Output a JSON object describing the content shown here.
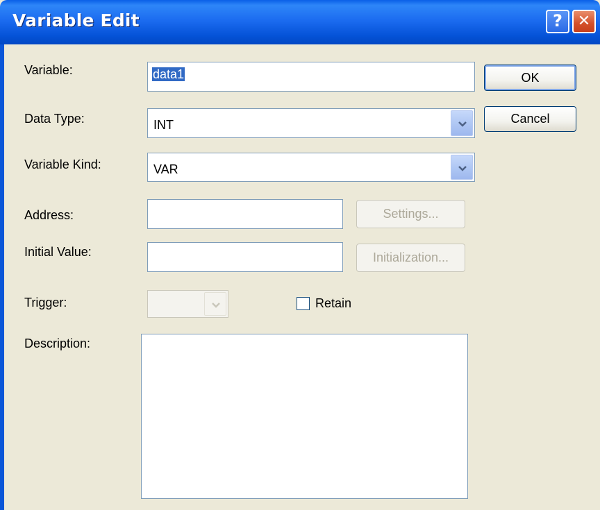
{
  "window": {
    "title": "Variable Edit",
    "help_glyph": "?",
    "close_glyph": "✕"
  },
  "form": {
    "variable_label": "Variable:",
    "variable_value": "data1",
    "data_type_label": "Data Type:",
    "data_type_value": "INT",
    "variable_kind_label": "Variable Kind:",
    "variable_kind_value": "VAR",
    "address_label": "Address:",
    "address_value": "",
    "initial_value_label": "Initial Value:",
    "initial_value_value": "",
    "trigger_label": "Trigger:",
    "trigger_value": "",
    "retain_label": "Retain",
    "retain_checked": false,
    "description_label": "Description:",
    "description_value": ""
  },
  "buttons": {
    "ok_label": "OK",
    "cancel_label": "Cancel",
    "settings_label": "Settings...",
    "initialization_label": "Initialization..."
  },
  "colors": {
    "titlebar": "#0553D8",
    "dialog_bg": "#ECE9D8",
    "selection": "#316AC5",
    "disabled_text": "#ACA899"
  },
  "icons": {
    "help": "help-icon",
    "close": "close-icon",
    "dropdown": "chevron-down-icon"
  }
}
